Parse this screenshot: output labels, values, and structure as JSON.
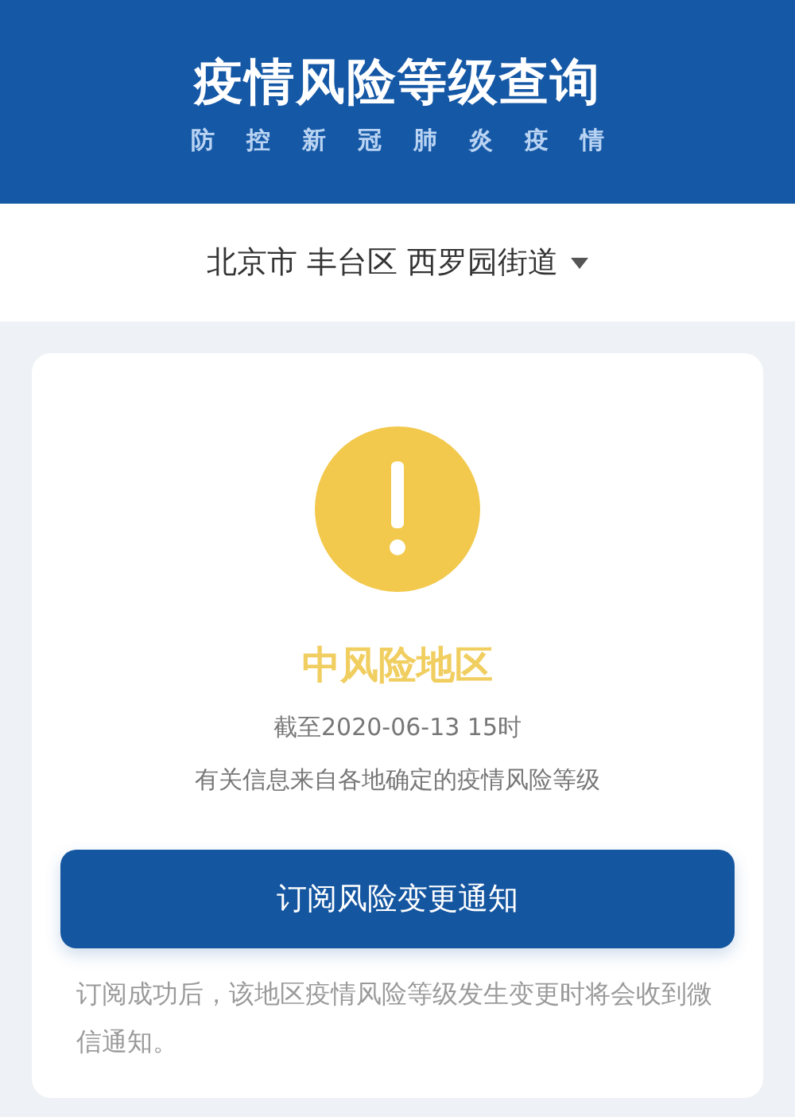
{
  "header": {
    "title": "疫情风险等级查询",
    "subtitle": "防控新冠肺炎疫情"
  },
  "location": {
    "city": "北京市",
    "district": "丰台区",
    "street": "西罗园街道"
  },
  "result": {
    "kind": "medium",
    "level_label": "中风险地区",
    "as_of": "截至2020-06-13 15时",
    "source_note": "有关信息来自各地确定的疫情风险等级"
  },
  "subscribe_button": "订阅风险变更通知",
  "footnote": "订阅成功后，该地区疫情风险等级发生变更时将会收到微信通知。"
}
